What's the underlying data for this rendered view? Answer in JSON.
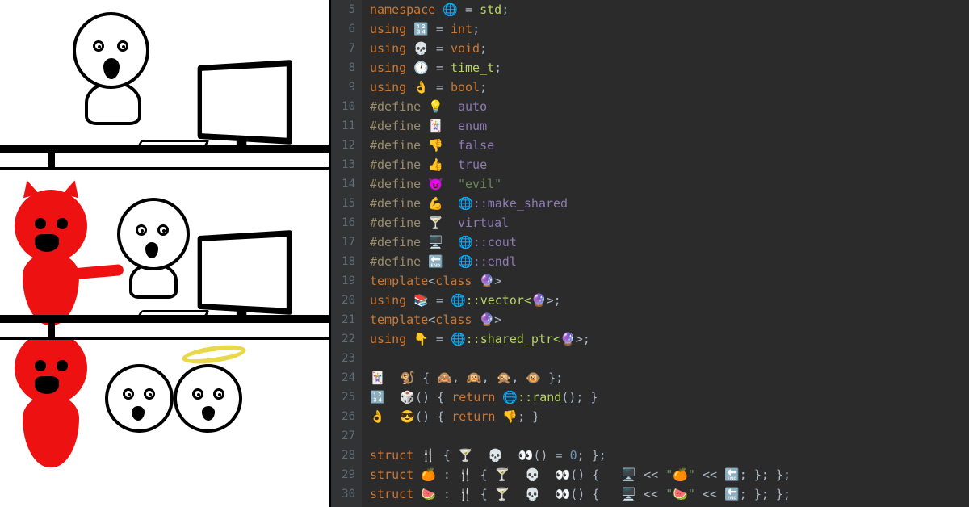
{
  "comic": {
    "panels": [
      {
        "desc": "shocked stick figure at computer"
      },
      {
        "desc": "red devil whispering to shocked figure at computer"
      },
      {
        "desc": "devil, shocked figure, and haloed angel figure (cropped)"
      }
    ]
  },
  "editor": {
    "first_line_number": 5,
    "lines": [
      [
        {
          "t": "namespace ",
          "c": "kw"
        },
        {
          "t": "🌐",
          "c": "emoji"
        },
        {
          "t": " = ",
          "c": "pun"
        },
        {
          "t": "std",
          "c": "ty"
        },
        {
          "t": ";",
          "c": "pun"
        }
      ],
      [
        {
          "t": "using ",
          "c": "kw"
        },
        {
          "t": "🔢",
          "c": "emoji"
        },
        {
          "t": " = ",
          "c": "pun"
        },
        {
          "t": "int",
          "c": "kw"
        },
        {
          "t": ";",
          "c": "pun"
        }
      ],
      [
        {
          "t": "using ",
          "c": "kw"
        },
        {
          "t": "💀",
          "c": "emoji"
        },
        {
          "t": " = ",
          "c": "pun"
        },
        {
          "t": "void",
          "c": "kw"
        },
        {
          "t": ";",
          "c": "pun"
        }
      ],
      [
        {
          "t": "using ",
          "c": "kw"
        },
        {
          "t": "🕐",
          "c": "emoji"
        },
        {
          "t": " = ",
          "c": "pun"
        },
        {
          "t": "time_t",
          "c": "ty"
        },
        {
          "t": ";",
          "c": "pun"
        }
      ],
      [
        {
          "t": "using ",
          "c": "kw"
        },
        {
          "t": "👌",
          "c": "emoji"
        },
        {
          "t": " = ",
          "c": "pun"
        },
        {
          "t": "bool",
          "c": "kw"
        },
        {
          "t": ";",
          "c": "pun"
        }
      ],
      [
        {
          "t": "#define ",
          "c": "pp"
        },
        {
          "t": "💡",
          "c": "emoji"
        },
        {
          "t": "  auto",
          "c": "mac"
        }
      ],
      [
        {
          "t": "#define ",
          "c": "pp"
        },
        {
          "t": "🃏",
          "c": "emoji"
        },
        {
          "t": "  enum",
          "c": "mac"
        }
      ],
      [
        {
          "t": "#define ",
          "c": "pp"
        },
        {
          "t": "👎",
          "c": "emoji"
        },
        {
          "t": "  false",
          "c": "mac"
        }
      ],
      [
        {
          "t": "#define ",
          "c": "pp"
        },
        {
          "t": "👍",
          "c": "emoji"
        },
        {
          "t": "  true",
          "c": "mac"
        }
      ],
      [
        {
          "t": "#define ",
          "c": "pp"
        },
        {
          "t": "😈",
          "c": "emoji"
        },
        {
          "t": "  ",
          "c": ""
        },
        {
          "t": "\"evil\"",
          "c": "str"
        }
      ],
      [
        {
          "t": "#define ",
          "c": "pp"
        },
        {
          "t": "💪",
          "c": "emoji"
        },
        {
          "t": "  ",
          "c": ""
        },
        {
          "t": "🌐",
          "c": "emoji"
        },
        {
          "t": "::make_shared",
          "c": "mac"
        }
      ],
      [
        {
          "t": "#define ",
          "c": "pp"
        },
        {
          "t": "🍸",
          "c": "emoji"
        },
        {
          "t": "  virtual",
          "c": "mac"
        }
      ],
      [
        {
          "t": "#define ",
          "c": "pp"
        },
        {
          "t": "🖥",
          "c": "emoji"
        },
        {
          "t": "  ",
          "c": ""
        },
        {
          "t": "🌐",
          "c": "emoji"
        },
        {
          "t": "::cout",
          "c": "mac"
        }
      ],
      [
        {
          "t": "#define ",
          "c": "pp"
        },
        {
          "t": "🔚",
          "c": "emoji"
        },
        {
          "t": "  ",
          "c": ""
        },
        {
          "t": "🌐",
          "c": "emoji"
        },
        {
          "t": "::endl",
          "c": "mac"
        }
      ],
      [
        {
          "t": "template",
          "c": "kw"
        },
        {
          "t": "<",
          "c": "pun"
        },
        {
          "t": "class ",
          "c": "kw"
        },
        {
          "t": "🔮",
          "c": "emoji"
        },
        {
          "t": ">",
          "c": "pun"
        }
      ],
      [
        {
          "t": "using ",
          "c": "kw"
        },
        {
          "t": "📚",
          "c": "emoji"
        },
        {
          "t": " = ",
          "c": "pun"
        },
        {
          "t": "🌐",
          "c": "emoji"
        },
        {
          "t": "::vector<",
          "c": "ty"
        },
        {
          "t": "🔮",
          "c": "emoji"
        },
        {
          "t": ">;",
          "c": "pun"
        }
      ],
      [
        {
          "t": "template",
          "c": "kw"
        },
        {
          "t": "<",
          "c": "pun"
        },
        {
          "t": "class ",
          "c": "kw"
        },
        {
          "t": "🔮",
          "c": "emoji"
        },
        {
          "t": ">",
          "c": "pun"
        }
      ],
      [
        {
          "t": "using ",
          "c": "kw"
        },
        {
          "t": "👇",
          "c": "emoji"
        },
        {
          "t": " = ",
          "c": "pun"
        },
        {
          "t": "🌐",
          "c": "emoji"
        },
        {
          "t": "::shared_ptr<",
          "c": "ty"
        },
        {
          "t": "🔮",
          "c": "emoji"
        },
        {
          "t": ">;",
          "c": "pun"
        }
      ],
      [],
      [
        {
          "t": "🃏 ",
          "c": "emoji"
        },
        {
          "t": "🐒",
          "c": "emoji"
        },
        {
          "t": " { ",
          "c": "pun"
        },
        {
          "t": "🙈",
          "c": "emoji"
        },
        {
          "t": ", ",
          "c": "pun"
        },
        {
          "t": "🙉",
          "c": "emoji"
        },
        {
          "t": ", ",
          "c": "pun"
        },
        {
          "t": "🙊",
          "c": "emoji"
        },
        {
          "t": ", ",
          "c": "pun"
        },
        {
          "t": "🐵",
          "c": "emoji"
        },
        {
          "t": " };",
          "c": "pun"
        }
      ],
      [
        {
          "t": "🔢 ",
          "c": "emoji"
        },
        {
          "t": "🎲",
          "c": "emoji"
        },
        {
          "t": "() { ",
          "c": "pun"
        },
        {
          "t": "return ",
          "c": "kw"
        },
        {
          "t": "🌐",
          "c": "emoji"
        },
        {
          "t": "::rand",
          "c": "ty"
        },
        {
          "t": "(); }",
          "c": "pun"
        }
      ],
      [
        {
          "t": "👌 ",
          "c": "emoji"
        },
        {
          "t": "😎",
          "c": "emoji"
        },
        {
          "t": "() { ",
          "c": "pun"
        },
        {
          "t": "return ",
          "c": "kw"
        },
        {
          "t": "👎",
          "c": "emoji"
        },
        {
          "t": "; }",
          "c": "pun"
        }
      ],
      [],
      [
        {
          "t": "struct ",
          "c": "kw"
        },
        {
          "t": "🍴",
          "c": "emoji"
        },
        {
          "t": " { ",
          "c": "pun"
        },
        {
          "t": "🍸 ",
          "c": "emoji"
        },
        {
          "t": "💀 ",
          "c": "emoji"
        },
        {
          "t": "👀",
          "c": "emoji"
        },
        {
          "t": "() = ",
          "c": "pun"
        },
        {
          "t": "0",
          "c": "num"
        },
        {
          "t": "; };",
          "c": "pun"
        }
      ],
      [
        {
          "t": "struct ",
          "c": "kw"
        },
        {
          "t": "🍊",
          "c": "emoji"
        },
        {
          "t": " : ",
          "c": "pun"
        },
        {
          "t": "🍴",
          "c": "emoji"
        },
        {
          "t": " { ",
          "c": "pun"
        },
        {
          "t": "🍸 ",
          "c": "emoji"
        },
        {
          "t": "💀 ",
          "c": "emoji"
        },
        {
          "t": "👀",
          "c": "emoji"
        },
        {
          "t": "() {   ",
          "c": "pun"
        },
        {
          "t": "🖥",
          "c": "emoji"
        },
        {
          "t": " << ",
          "c": "pun"
        },
        {
          "t": "\"🍊\"",
          "c": "str"
        },
        {
          "t": " << ",
          "c": "pun"
        },
        {
          "t": "🔚",
          "c": "emoji"
        },
        {
          "t": "; }; };",
          "c": "pun"
        }
      ],
      [
        {
          "t": "struct ",
          "c": "kw"
        },
        {
          "t": "🍉",
          "c": "emoji"
        },
        {
          "t": " : ",
          "c": "pun"
        },
        {
          "t": "🍴",
          "c": "emoji"
        },
        {
          "t": " { ",
          "c": "pun"
        },
        {
          "t": "🍸 ",
          "c": "emoji"
        },
        {
          "t": "💀 ",
          "c": "emoji"
        },
        {
          "t": "👀",
          "c": "emoji"
        },
        {
          "t": "() {   ",
          "c": "pun"
        },
        {
          "t": "🖥",
          "c": "emoji"
        },
        {
          "t": " << ",
          "c": "pun"
        },
        {
          "t": "\"🍉\"",
          "c": "str"
        },
        {
          "t": " << ",
          "c": "pun"
        },
        {
          "t": "🔚",
          "c": "emoji"
        },
        {
          "t": "; }; };",
          "c": "pun"
        }
      ]
    ]
  }
}
